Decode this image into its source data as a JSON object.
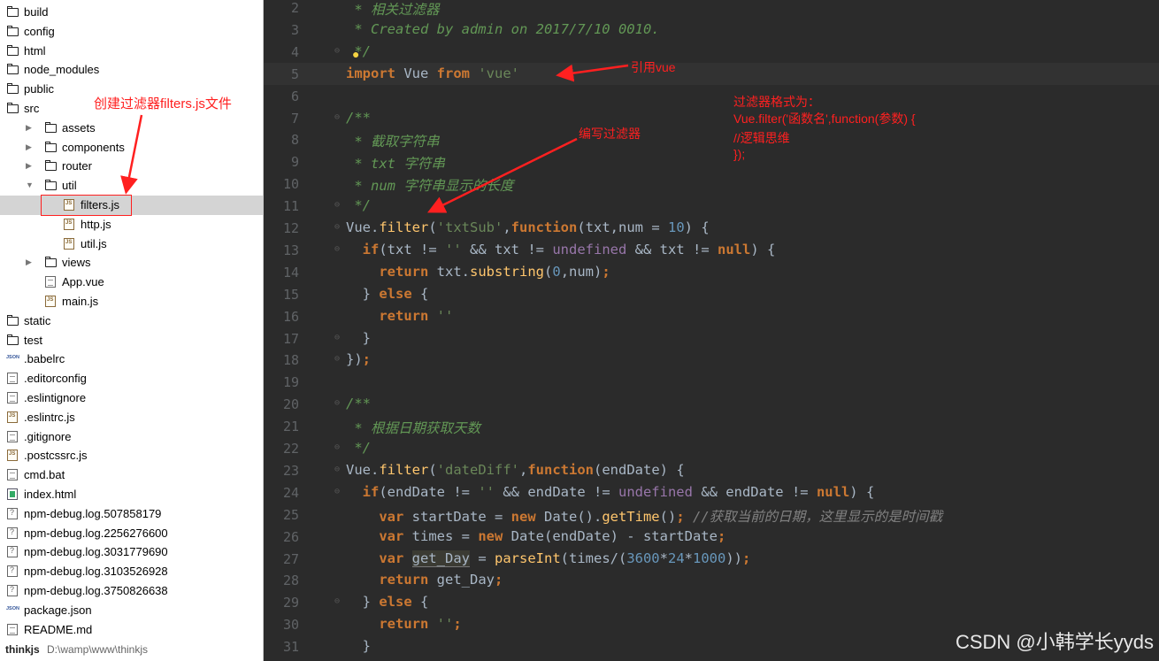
{
  "sidebar": {
    "items": [
      {
        "label": "build",
        "type": "folder",
        "depth": 0
      },
      {
        "label": "config",
        "type": "folder",
        "depth": 0
      },
      {
        "label": "html",
        "type": "folder",
        "depth": 0
      },
      {
        "label": "node_modules",
        "type": "folder",
        "depth": 0
      },
      {
        "label": "public",
        "type": "folder",
        "depth": 0
      },
      {
        "label": "src",
        "type": "folder",
        "depth": 0
      },
      {
        "label": "assets",
        "type": "folder",
        "depth": 1,
        "arrow": "▶"
      },
      {
        "label": "components",
        "type": "folder",
        "depth": 1,
        "arrow": "▶"
      },
      {
        "label": "router",
        "type": "folder",
        "depth": 1,
        "arrow": "▶"
      },
      {
        "label": "util",
        "type": "folder",
        "depth": 1,
        "arrow": "▼"
      },
      {
        "label": "filters.js",
        "type": "js",
        "depth": 2,
        "selected": true
      },
      {
        "label": "http.js",
        "type": "js",
        "depth": 2
      },
      {
        "label": "util.js",
        "type": "js",
        "depth": 2
      },
      {
        "label": "views",
        "type": "folder",
        "depth": 1,
        "arrow": "▶"
      },
      {
        "label": "App.vue",
        "type": "file",
        "depth": 1
      },
      {
        "label": "main.js",
        "type": "js",
        "depth": 1
      },
      {
        "label": "static",
        "type": "folder",
        "depth": 0
      },
      {
        "label": "test",
        "type": "folder",
        "depth": 0
      },
      {
        "label": ".babelrc",
        "type": "json",
        "depth": 0
      },
      {
        "label": ".editorconfig",
        "type": "file",
        "depth": 0
      },
      {
        "label": ".eslintignore",
        "type": "file",
        "depth": 0
      },
      {
        "label": ".eslintrc.js",
        "type": "js",
        "depth": 0
      },
      {
        "label": ".gitignore",
        "type": "file",
        "depth": 0
      },
      {
        "label": ".postcssrc.js",
        "type": "js",
        "depth": 0
      },
      {
        "label": "cmd.bat",
        "type": "file",
        "depth": 0
      },
      {
        "label": "index.html",
        "type": "html",
        "depth": 0
      },
      {
        "label": "npm-debug.log.507858179",
        "type": "log",
        "depth": 0
      },
      {
        "label": "npm-debug.log.2256276600",
        "type": "log",
        "depth": 0
      },
      {
        "label": "npm-debug.log.3031779690",
        "type": "log",
        "depth": 0
      },
      {
        "label": "npm-debug.log.3103526928",
        "type": "log",
        "depth": 0
      },
      {
        "label": "npm-debug.log.3750826638",
        "type": "log",
        "depth": 0
      },
      {
        "label": "package.json",
        "type": "json",
        "depth": 0
      },
      {
        "label": "README.md",
        "type": "file",
        "depth": 0
      }
    ],
    "project_name": "thinkjs",
    "project_path": "D:\\wamp\\www\\thinkjs"
  },
  "editor": {
    "lines": [
      {
        "n": "2",
        "fold": "",
        "html": "<span class=\"cm\"> * 相关过滤器</span>"
      },
      {
        "n": "3",
        "fold": "",
        "html": "<span class=\"cm\"> * Created by admin on 2017/7/10 0010.</span>"
      },
      {
        "n": "4",
        "fold": "⊖",
        "html": "<span class=\"cm\"> */</span>"
      },
      {
        "n": "5",
        "fold": "",
        "current": true,
        "html": "<span class=\"kw\">import</span> Vue <span class=\"kw\">from</span> <span class=\"str\">'vue'</span>"
      },
      {
        "n": "6",
        "fold": "",
        "html": ""
      },
      {
        "n": "7",
        "fold": "⊖",
        "html": "<span class=\"cm\">/**</span>"
      },
      {
        "n": "8",
        "fold": "",
        "html": "<span class=\"cm\"> * 截取字符串</span>"
      },
      {
        "n": "9",
        "fold": "",
        "html": "<span class=\"cm\"> * txt 字符串</span>"
      },
      {
        "n": "10",
        "fold": "",
        "html": "<span class=\"cm\"> * num 字符串显示的长度</span>"
      },
      {
        "n": "11",
        "fold": "⊖",
        "html": "<span class=\"cm\"> */</span>"
      },
      {
        "n": "12",
        "fold": "⊖",
        "html": "Vue.<span class=\"fn\">filter</span>(<span class=\"str\">'txtSub'</span>,<span class=\"kw\">function</span>(txt,num = <span class=\"num\">10</span>) {"
      },
      {
        "n": "13",
        "fold": "⊖",
        "html": "  <span class=\"kw\">if</span>(txt != <span class=\"str\">''</span> &amp;&amp; txt != <span class=\"purple\">undefined</span> &amp;&amp; txt != <span class=\"kw\">null</span>) {"
      },
      {
        "n": "14",
        "fold": "",
        "html": "    <span class=\"kw\">return</span> txt.<span class=\"fn\">substring</span>(<span class=\"num\">0</span>,num)<span class=\"kw\">;</span>"
      },
      {
        "n": "15",
        "fold": "",
        "html": "  } <span class=\"kw\">else</span> {"
      },
      {
        "n": "16",
        "fold": "",
        "html": "    <span class=\"kw\">return</span> <span class=\"str\">''</span>"
      },
      {
        "n": "17",
        "fold": "⊖",
        "html": "  }"
      },
      {
        "n": "18",
        "fold": "⊖",
        "html": "})<span class=\"kw\">;</span>"
      },
      {
        "n": "19",
        "fold": "",
        "html": ""
      },
      {
        "n": "20",
        "fold": "⊖",
        "html": "<span class=\"cm\">/**</span>"
      },
      {
        "n": "21",
        "fold": "",
        "html": "<span class=\"cm\"> * 根据日期获取天数</span>"
      },
      {
        "n": "22",
        "fold": "⊖",
        "html": "<span class=\"cm\"> */</span>"
      },
      {
        "n": "23",
        "fold": "⊖",
        "html": "Vue.<span class=\"fn\">filter</span>(<span class=\"str\">'dateDiff'</span>,<span class=\"kw\">function</span>(endDate) {"
      },
      {
        "n": "24",
        "fold": "⊖",
        "html": "  <span class=\"kw\">if</span>(endDate != <span class=\"str\">''</span> &amp;&amp; endDate != <span class=\"purple\">undefined</span> &amp;&amp; endDate != <span class=\"kw\">null</span>) {"
      },
      {
        "n": "25",
        "fold": "",
        "html": "    <span class=\"kw\">var</span> startDate = <span class=\"kw\">new</span> Date().<span class=\"fn\">getTime</span>()<span class=\"kw\">;</span> <span class=\"ln-cm\">//获取当前的日期，这里显示的是时间戳</span>"
      },
      {
        "n": "26",
        "fold": "",
        "html": "    <span class=\"kw\">var</span> times = <span class=\"kw\">new</span> Date(endDate) - startDate<span class=\"kw\">;</span>"
      },
      {
        "n": "27",
        "fold": "",
        "html": "    <span class=\"kw\">var</span> <span class=\"hl\">get_Day</span> = <span class=\"fn\">parseInt</span>(times/(<span class=\"num\">3600</span>*<span class=\"num\">24</span>*<span class=\"num\">1000</span>))<span class=\"kw\">;</span>"
      },
      {
        "n": "28",
        "fold": "",
        "html": "    <span class=\"kw\">return</span> get_Day<span class=\"kw\">;</span>"
      },
      {
        "n": "29",
        "fold": "⊖",
        "html": "  } <span class=\"kw\">else</span> {"
      },
      {
        "n": "30",
        "fold": "",
        "html": "    <span class=\"kw\">return</span> <span class=\"str\">''</span><span class=\"kw\">;</span>"
      },
      {
        "n": "31",
        "fold": "",
        "html": "  }"
      }
    ]
  },
  "annotations": {
    "create_file": "创建过滤器filters.js文件",
    "import_vue": "引用vue",
    "write_filter": "编写过滤器",
    "format_title": "过滤器格式为：",
    "format_line1": "Vue.filter('函数名',function(参数) {",
    "format_line2": "//逻辑思维",
    "format_line3": "});"
  },
  "watermark": "CSDN @小韩学长yyds",
  "colors": {
    "annotation": "#ff2020",
    "editor_bg": "#2b2b2b",
    "keyword": "#cc7832",
    "string": "#6a8759",
    "comment": "#629755"
  }
}
